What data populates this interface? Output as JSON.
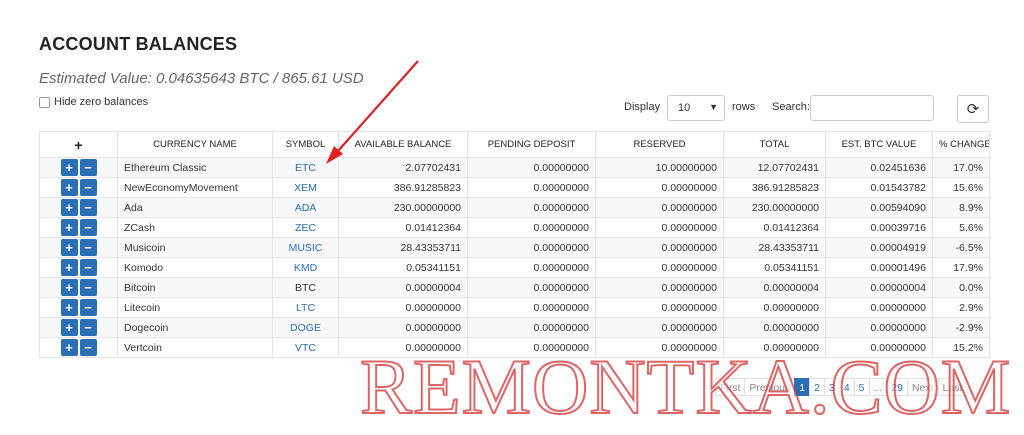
{
  "page": {
    "title": "ACCOUNT BALANCES",
    "estimated_value": "Estimated Value: 0.04635643 BTC / 865.61 USD",
    "hide_zero_label": "Hide zero balances"
  },
  "controls": {
    "display_label": "Display",
    "rows_value": "10",
    "rows_label": "rows",
    "search_label": "Search:",
    "search_placeholder": "",
    "refresh_icon": "refresh-icon"
  },
  "table": {
    "add_header": "+",
    "columns": [
      "CURRENCY NAME",
      "SYMBOL",
      "AVAILABLE BALANCE",
      "PENDING DEPOSIT",
      "RESERVED",
      "TOTAL",
      "EST. BTC VALUE",
      "% CHANGE"
    ],
    "plus_glyph": "+",
    "minus_glyph": "−",
    "rows": [
      {
        "name": "Ethereum Classic",
        "symbol": "ETC",
        "available": "2.07702431",
        "pending": "0.00000000",
        "reserved": "10.00000000",
        "total": "12.07702431",
        "btc": "0.02451636",
        "change": "17.0%"
      },
      {
        "name": "NewEconomyMovement",
        "symbol": "XEM",
        "available": "386.91285823",
        "pending": "0.00000000",
        "reserved": "0.00000000",
        "total": "386.91285823",
        "btc": "0.01543782",
        "change": "15.6%"
      },
      {
        "name": "Ada",
        "symbol": "ADA",
        "available": "230.00000000",
        "pending": "0.00000000",
        "reserved": "0.00000000",
        "total": "230.00000000",
        "btc": "0.00594090",
        "change": "8.9%"
      },
      {
        "name": "ZCash",
        "symbol": "ZEC",
        "available": "0.01412364",
        "pending": "0.00000000",
        "reserved": "0.00000000",
        "total": "0.01412364",
        "btc": "0.00039716",
        "change": "5.6%"
      },
      {
        "name": "Musicoin",
        "symbol": "MUSIC",
        "available": "28.43353711",
        "pending": "0.00000000",
        "reserved": "0.00000000",
        "total": "28.43353711",
        "btc": "0.00004919",
        "change": "-6.5%"
      },
      {
        "name": "Komodo",
        "symbol": "KMD",
        "available": "0.05341151",
        "pending": "0.00000000",
        "reserved": "0.00000000",
        "total": "0.05341151",
        "btc": "0.00001496",
        "change": "17.9%"
      },
      {
        "name": "Bitcoin",
        "symbol": "BTC",
        "available": "0.00000004",
        "pending": "0.00000000",
        "reserved": "0.00000000",
        "total": "0.00000004",
        "btc": "0.00000004",
        "change": "0.0%"
      },
      {
        "name": "Litecoin",
        "symbol": "LTC",
        "available": "0.00000000",
        "pending": "0.00000000",
        "reserved": "0.00000000",
        "total": "0.00000000",
        "btc": "0.00000000",
        "change": "2.9%"
      },
      {
        "name": "Dogecoin",
        "symbol": "DOGE",
        "available": "0.00000000",
        "pending": "0.00000000",
        "reserved": "0.00000000",
        "total": "0.00000000",
        "btc": "0.00000000",
        "change": "-2.9%"
      },
      {
        "name": "Vertcoin",
        "symbol": "VTC",
        "available": "0.00000000",
        "pending": "0.00000000",
        "reserved": "0.00000000",
        "total": "0.00000000",
        "btc": "0.00000000",
        "change": "15.2%"
      }
    ]
  },
  "pagination": {
    "first": "First",
    "previous": "Previous",
    "pages": [
      "1",
      "2",
      "3",
      "4",
      "5"
    ],
    "ellipsis": "...",
    "last_page": "29",
    "next": "Next",
    "last": "Last"
  },
  "watermark": "REMONTKA.COM",
  "colors": {
    "accent": "#2a6eb5",
    "annotation_arrow": "#e02020"
  }
}
